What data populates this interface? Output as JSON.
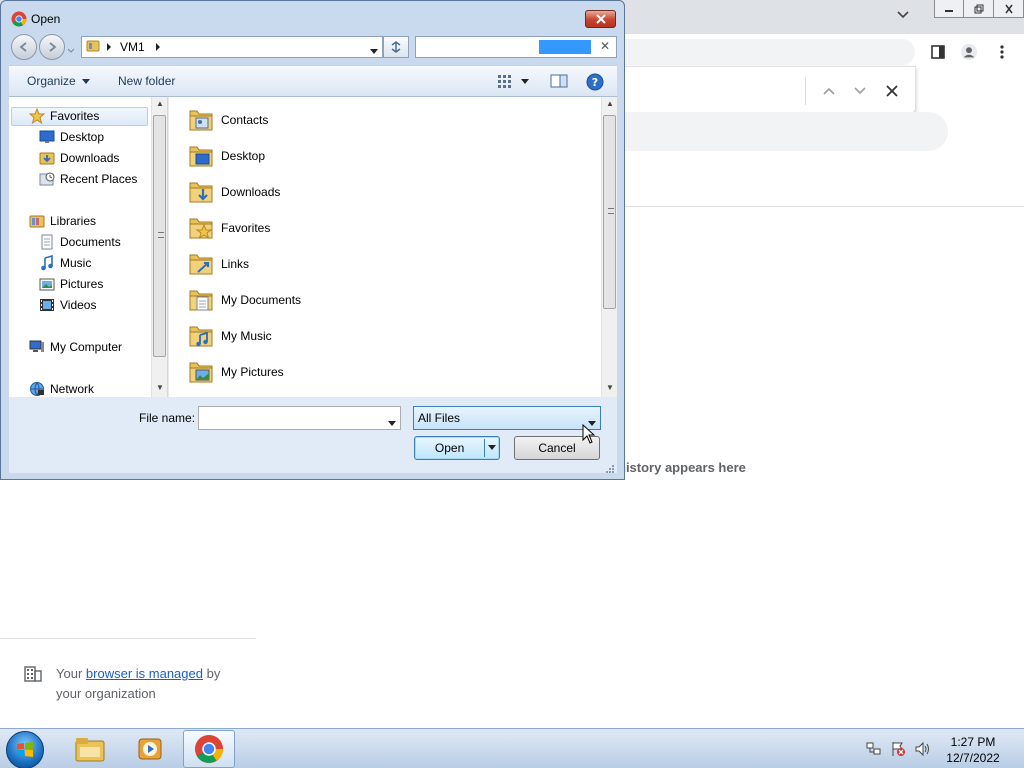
{
  "browser": {
    "history_empty_text": "history appears here",
    "managed": {
      "prefix": "Your",
      "link": "browser is managed",
      "suffix": "by your organization"
    }
  },
  "dialog": {
    "title": "Open",
    "address": {
      "segment": "VM1"
    },
    "search": {
      "value": "",
      "placeholder": ""
    },
    "command_bar": {
      "organize_label": "Organize",
      "new_folder_label": "New folder"
    },
    "nav_tree": [
      {
        "label": "Favorites",
        "icon": "star-icon",
        "indent": 0,
        "selected": true
      },
      {
        "label": "Desktop",
        "icon": "desktop-icon",
        "indent": 1
      },
      {
        "label": "Downloads",
        "icon": "downloads-folder-icon",
        "indent": 1
      },
      {
        "label": "Recent Places",
        "icon": "recent-places-icon",
        "indent": 1
      },
      {
        "label": "Libraries",
        "icon": "libraries-icon",
        "indent": 0
      },
      {
        "label": "Documents",
        "icon": "documents-icon",
        "indent": 1
      },
      {
        "label": "Music",
        "icon": "music-icon",
        "indent": 1
      },
      {
        "label": "Pictures",
        "icon": "pictures-icon",
        "indent": 1
      },
      {
        "label": "Videos",
        "icon": "videos-icon",
        "indent": 1
      },
      {
        "label": "My Computer",
        "icon": "computer-icon",
        "indent": 0
      },
      {
        "label": "Network",
        "icon": "network-icon",
        "indent": 0
      }
    ],
    "files": [
      {
        "name": "Contacts",
        "icon": "contacts-folder-icon"
      },
      {
        "name": "Desktop",
        "icon": "desktop-folder-icon"
      },
      {
        "name": "Downloads",
        "icon": "downloads-folder-icon"
      },
      {
        "name": "Favorites",
        "icon": "favorites-folder-icon"
      },
      {
        "name": "Links",
        "icon": "links-folder-icon"
      },
      {
        "name": "My Documents",
        "icon": "documents-folder-icon"
      },
      {
        "name": "My Music",
        "icon": "music-folder-icon"
      },
      {
        "name": "My Pictures",
        "icon": "pictures-folder-icon"
      }
    ],
    "file_name_label": "File name:",
    "file_name_value": "",
    "file_type": "All Files",
    "open_label": "Open",
    "cancel_label": "Cancel"
  },
  "taskbar": {
    "apps": [
      {
        "name": "explorer",
        "icon": "folder-icon"
      },
      {
        "name": "media-player",
        "icon": "media-player-icon"
      },
      {
        "name": "chrome",
        "icon": "chrome-icon",
        "active": true
      }
    ],
    "clock": {
      "time": "1:27 PM",
      "date": "12/7/2022"
    }
  },
  "colors": {
    "dialog_frame": "#c9daee",
    "selection": "#dde9f8",
    "chrome_tabstrip": "#dee1e6",
    "link": "#1a5dc4"
  }
}
